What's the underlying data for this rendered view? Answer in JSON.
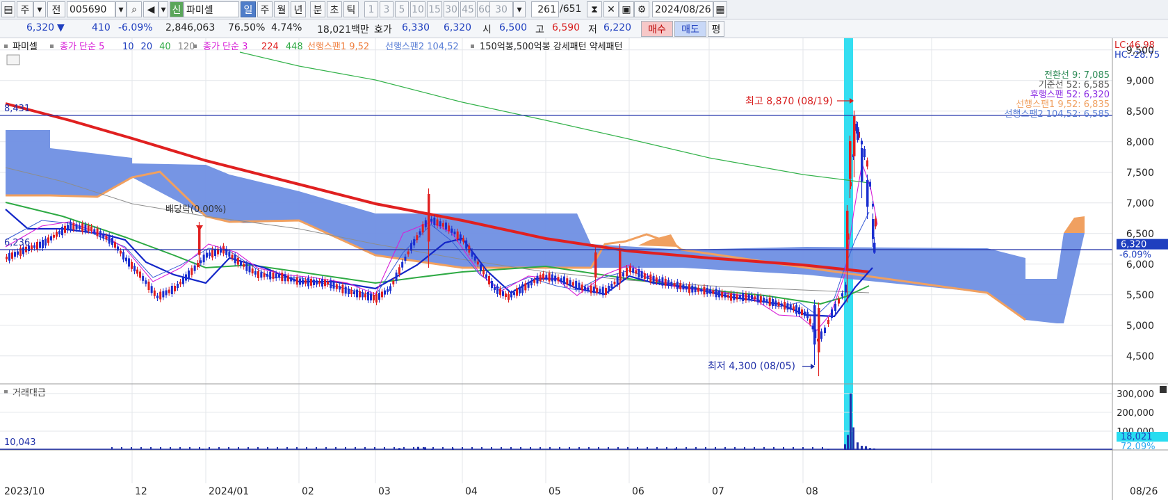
{
  "toolbar": {
    "period_mode": "주",
    "prev_label": "전",
    "code": "005690",
    "stock_name": "파미셀",
    "name_badge": "신",
    "periods": [
      "일",
      "주",
      "월",
      "년",
      "분",
      "초",
      "틱"
    ],
    "intervals": [
      "1",
      "3",
      "5",
      "10",
      "15",
      "30",
      "45",
      "60"
    ],
    "interval_value": "30",
    "count_current": "261",
    "count_total": "/651",
    "date": "2024/08/26"
  },
  "quote": {
    "price": "6,320",
    "change_arrow": "▼",
    "change": "410",
    "change_pct": "-6.09%",
    "volume": "2,846,063",
    "volume_ratio": "76.50%",
    "turnover": "4.74%",
    "amount": "18,021백만",
    "bid_label": "호가",
    "ask_price": "6,330",
    "bid_price": "6,320",
    "open_label": "시",
    "open": "6,500",
    "high_label": "고",
    "high": "6,590",
    "low_label": "저",
    "low": "6,220",
    "buy_label": "매수",
    "sell_label": "매도",
    "avg_label": "평"
  },
  "legend": {
    "name": "파미셀",
    "ma5_label": "종가 단순 5",
    "ma_periods_a": [
      "10",
      "20",
      "40",
      "120"
    ],
    "ma3_label": "종가 단순 3",
    "ma_periods_b": [
      "224",
      "448"
    ],
    "span1_label": "선행스팬1 9,52",
    "span2_label": "선행스팬2 104,52",
    "pattern_label": "150억봉,500억봉 강세패턴  약세패턴"
  },
  "right_info": {
    "lc": "LC:46.98",
    "hc": "HC:-28.75",
    "current_price_tag": "6,320",
    "current_change_tag": "-6.09%",
    "ichimoku": [
      {
        "text": "전환선 9: 7,085",
        "color": "#2e8b57"
      },
      {
        "text": "기준선 52: 6,585",
        "color": "#555555"
      },
      {
        "text": "후행스팬 52: 6,320",
        "color": "#8a2be2"
      },
      {
        "text": "선행스팬1 9,52: 6,835",
        "color": "#f0a060"
      },
      {
        "text": "선행스팬2 104,52: 6,585",
        "color": "#5a7fd6"
      }
    ]
  },
  "annotations": {
    "max_label": "최고 8,870 (08/19)",
    "min_label": "최저 4,300 (08/05)",
    "dividend_label": "배당락(0.00%)",
    "level_high": "8,431",
    "level_low": "6,236"
  },
  "volume_panel": {
    "title": "거래대금",
    "left_value": "10,043",
    "current_tag": "18,021",
    "current_pct_tag": "72.09%"
  },
  "chart_data": {
    "type": "candlestick",
    "title": "",
    "y_axis": {
      "ticks": [
        4500,
        5000,
        5500,
        6000,
        6500,
        7000,
        7500,
        8000,
        8500,
        9000,
        9500
      ],
      "range": [
        4100,
        9600
      ]
    },
    "volume_axis": {
      "ticks": [
        100000,
        200000,
        300000
      ],
      "range": [
        0,
        340000
      ]
    },
    "x_ticks": [
      "2023/10",
      "12",
      "2024/01",
      "02",
      "03",
      "04",
      "05",
      "06",
      "07",
      "08",
      "08/26"
    ],
    "horizontal_levels": [
      8431,
      6236
    ],
    "max": {
      "value": 8870,
      "date": "08/19"
    },
    "min": {
      "value": 4300,
      "date": "08/05"
    },
    "current_price": 6320,
    "series": [
      {
        "name": "종가 단순 5",
        "color": "#d81ed8"
      },
      {
        "name": "종가 단순 3",
        "color": "#d81ed8"
      },
      {
        "name": "224",
        "color": "#e02020"
      },
      {
        "name": "448",
        "color": "#2eaa44"
      },
      {
        "name": "선행스팬1 9,52",
        "color": "#f0a060"
      },
      {
        "name": "선행스팬2 104,52",
        "color": "#5a7fd6"
      }
    ],
    "ma224": [
      {
        "x": "2023/10",
        "y": 8850
      },
      {
        "x": "12",
        "y": 8300
      },
      {
        "x": "2024/01",
        "y": 7880
      },
      {
        "x": "02",
        "y": 7500
      },
      {
        "x": "03",
        "y": 7120
      },
      {
        "x": "04",
        "y": 6780
      },
      {
        "x": "05",
        "y": 6500
      },
      {
        "x": "06",
        "y": 6290
      },
      {
        "x": "07",
        "y": 6130
      },
      {
        "x": "08",
        "y": 6000
      },
      {
        "x": "08/26",
        "y": 5890
      }
    ],
    "ma448": [
      {
        "x": "2024/01",
        "y": 9600
      },
      {
        "x": "02",
        "y": 9350
      },
      {
        "x": "03",
        "y": 9050
      },
      {
        "x": "04",
        "y": 8700
      },
      {
        "x": "05",
        "y": 8350
      },
      {
        "x": "06",
        "y": 8050
      },
      {
        "x": "07",
        "y": 7750
      },
      {
        "x": "08",
        "y": 7550
      },
      {
        "x": "08/26",
        "y": 7450
      }
    ],
    "close": [
      {
        "x": "2023/10",
        "y": 6050
      },
      {
        "x": "11",
        "y": 6650
      },
      {
        "x": "12",
        "y": 5450
      },
      {
        "x": "2024/01",
        "y": 6150
      },
      {
        "x": "02",
        "y": 5750
      },
      {
        "x": "03",
        "y": 5500
      },
      {
        "x": "03m",
        "y": 6450
      },
      {
        "x": "04",
        "y": 6100
      },
      {
        "x": "04m",
        "y": 5500
      },
      {
        "x": "05",
        "y": 5800
      },
      {
        "x": "05m",
        "y": 5600
      },
      {
        "x": "06",
        "y": 6000
      },
      {
        "x": "06m",
        "y": 5700
      },
      {
        "x": "07",
        "y": 5500
      },
      {
        "x": "07m",
        "y": 5400
      },
      {
        "x": "08",
        "y": 5250
      },
      {
        "x": "08/05",
        "y": 4400
      },
      {
        "x": "08/12",
        "y": 5600
      },
      {
        "x": "08/19",
        "y": 8400
      },
      {
        "x": "08/21",
        "y": 7500
      },
      {
        "x": "08/26",
        "y": 6320
      }
    ],
    "cloud_span2": [
      {
        "x": "2023/10",
        "y": 8270
      },
      {
        "x": "11",
        "y": 8000
      },
      {
        "x": "12",
        "y": 7900
      },
      {
        "x": "2024/01",
        "y": 7600
      },
      {
        "x": "02",
        "y": 7250
      },
      {
        "x": "03",
        "y": 6900
      },
      {
        "x": "04",
        "y": 6900
      },
      {
        "x": "05",
        "y": 6900
      },
      {
        "x": "06",
        "y": 6300
      },
      {
        "x": "07",
        "y": 6300
      },
      {
        "x": "08",
        "y": 6300
      },
      {
        "x": "09",
        "y": 6250
      },
      {
        "x": "10",
        "y": 6550
      }
    ]
  }
}
